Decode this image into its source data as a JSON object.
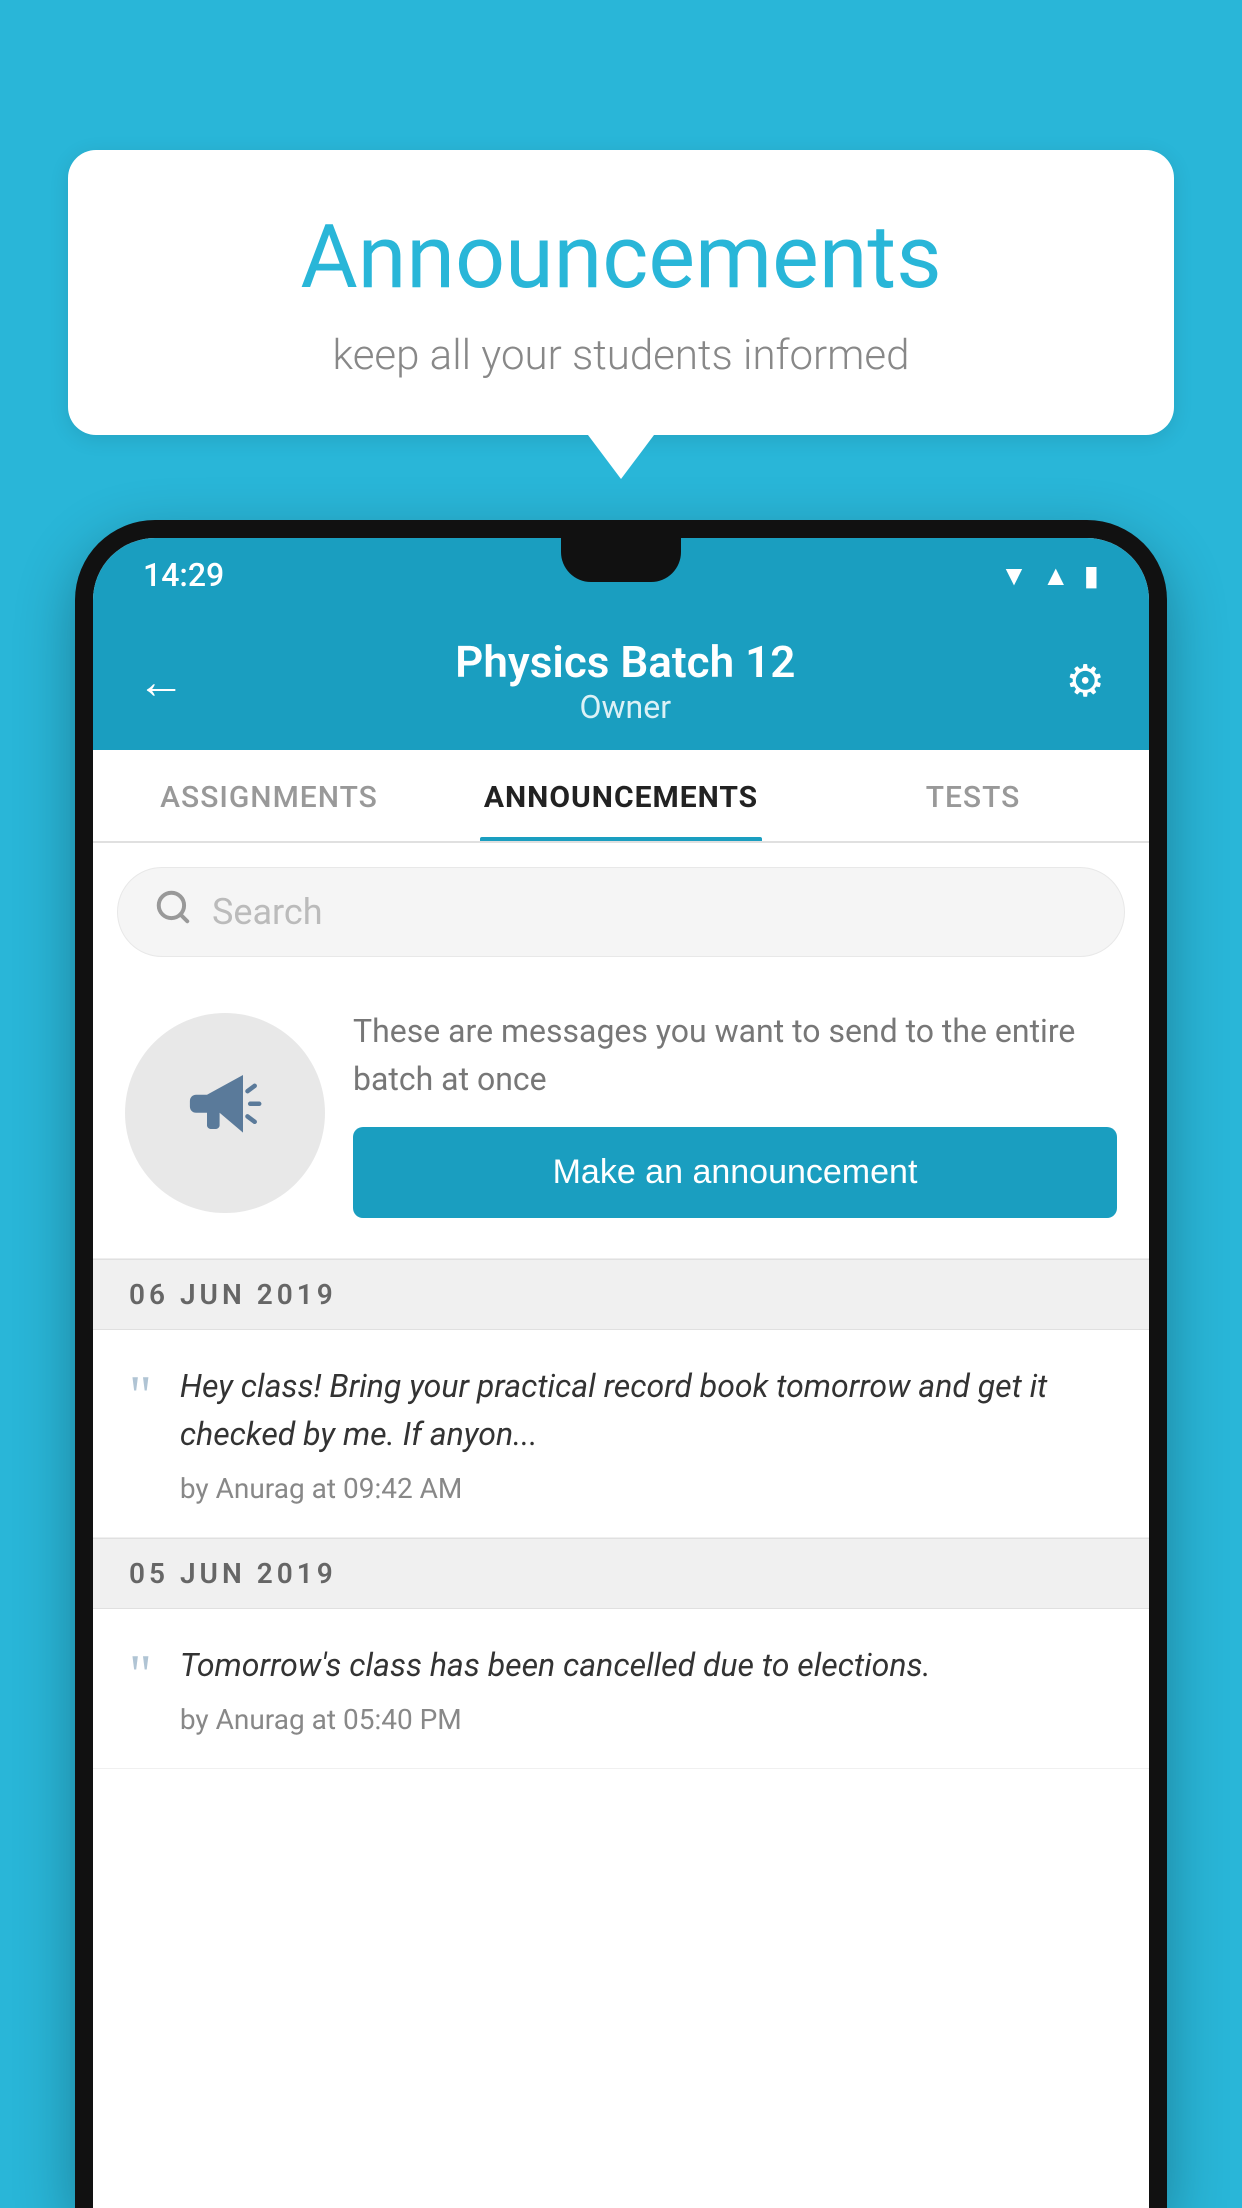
{
  "background": {
    "color": "#29b6d8"
  },
  "speech_bubble": {
    "title": "Announcements",
    "subtitle": "keep all your students informed"
  },
  "phone": {
    "status_bar": {
      "time": "14:29",
      "wifi": "▲",
      "signal": "▲",
      "battery": "▮"
    },
    "header": {
      "back_label": "←",
      "title": "Physics Batch 12",
      "subtitle": "Owner",
      "settings_label": "⚙"
    },
    "tabs": [
      {
        "label": "ASSIGNMENTS",
        "active": false
      },
      {
        "label": "ANNOUNCEMENTS",
        "active": true
      },
      {
        "label": "TESTS",
        "active": false
      }
    ],
    "search": {
      "placeholder": "Search"
    },
    "promo": {
      "description": "These are messages you want to send to the entire batch at once",
      "button_label": "Make an announcement"
    },
    "announcements": [
      {
        "date": "06  JUN  2019",
        "text": "Hey class! Bring your practical record book tomorrow and get it checked by me. If anyon...",
        "meta": "by Anurag at 09:42 AM"
      },
      {
        "date": "05  JUN  2019",
        "text": "Tomorrow's class has been cancelled due to elections.",
        "meta": "by Anurag at 05:40 PM"
      }
    ]
  }
}
